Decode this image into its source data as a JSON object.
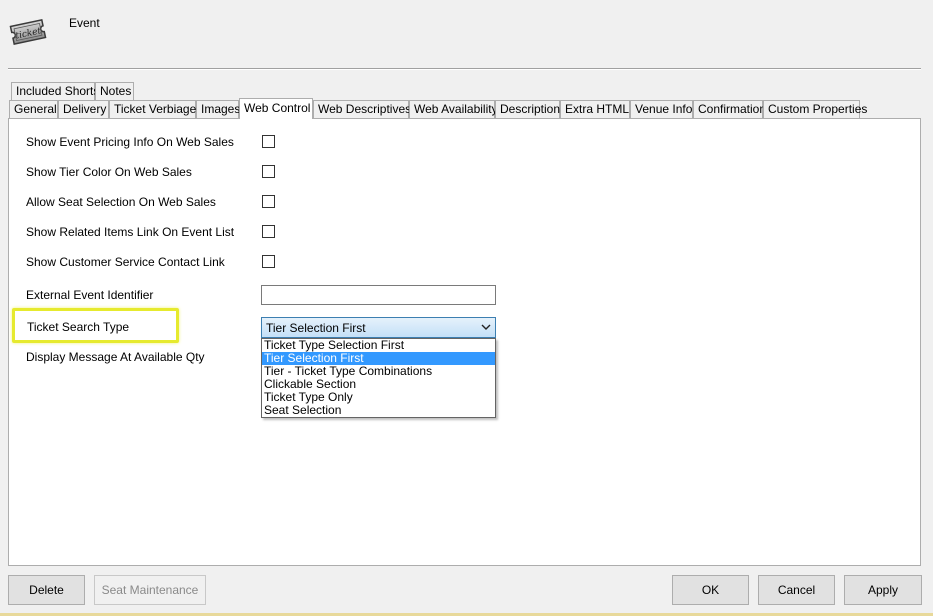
{
  "window": {
    "title": "Event",
    "logo_text": "ticket",
    "logo_icon": "ticket-icon"
  },
  "tabs": {
    "row1": [
      {
        "label": "Included Shorts"
      },
      {
        "label": "Notes"
      }
    ],
    "row2": [
      {
        "label": "General"
      },
      {
        "label": "Delivery"
      },
      {
        "label": "Ticket Verbiage"
      },
      {
        "label": "Images"
      },
      {
        "label": "Web Control",
        "active": true
      },
      {
        "label": "Web Descriptives"
      },
      {
        "label": "Web Availability"
      },
      {
        "label": "Description"
      },
      {
        "label": "Extra HTML"
      },
      {
        "label": "Venue Info"
      },
      {
        "label": "Confirmation"
      },
      {
        "label": "Custom Properties"
      }
    ]
  },
  "form": {
    "checkboxes": [
      {
        "label": "Show Event Pricing Info On Web Sales",
        "checked": false
      },
      {
        "label": "Show Tier Color On Web Sales",
        "checked": false
      },
      {
        "label": "Allow Seat Selection On Web Sales",
        "checked": false
      },
      {
        "label": "Show Related Items Link On Event List",
        "checked": false
      },
      {
        "label": "Show Customer Service Contact Link",
        "checked": false
      }
    ],
    "external_identifier": {
      "label": "External Event Identifier",
      "value": ""
    },
    "ticket_search_type": {
      "label": "Ticket Search Type",
      "selected": "Tier Selection First",
      "options": [
        "Ticket Type Selection First",
        "Tier Selection First",
        "Tier - Ticket Type Combinations",
        "Clickable Section",
        "Ticket Type Only",
        "Seat Selection"
      ],
      "highlighted_option_index": 1
    },
    "display_message_label": "Display Message At Available Qty"
  },
  "buttons": {
    "delete": "Delete",
    "seat_maintenance": "Seat Maintenance",
    "ok": "OK",
    "cancel": "Cancel",
    "apply": "Apply"
  },
  "colors": {
    "highlight_outline": "#e6ea2e",
    "selected_option_bg": "#3399ff"
  }
}
